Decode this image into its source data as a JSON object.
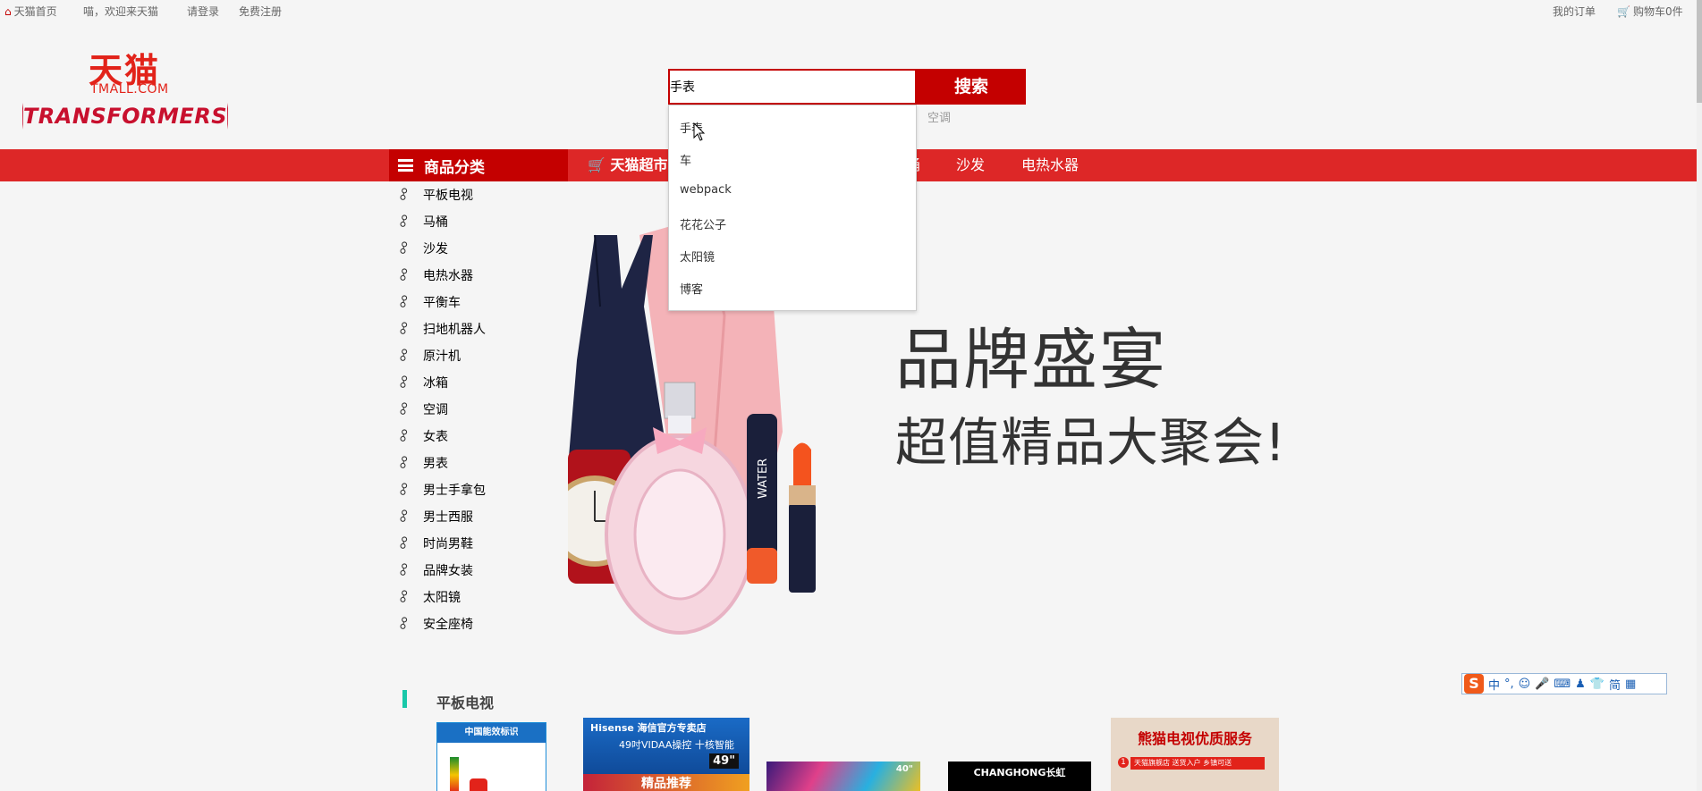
{
  "topbar": {
    "home": "天猫首页",
    "welcome": "喵，欢迎来天猫",
    "login": "请登录",
    "register": "免费注册",
    "orders": "我的订单",
    "cart": "购物车0件"
  },
  "logo": {
    "name_cn": "天猫",
    "domain": "TMALL.COM",
    "campaign": "TRANSFORMERS"
  },
  "search": {
    "value": "手表",
    "button": "搜索",
    "hot_words": [
      "空调"
    ],
    "suggestions": [
      "手表",
      "车",
      "webpack",
      "花花公子",
      "太阳镜",
      "博客"
    ]
  },
  "nav": {
    "category_label": "商品分类",
    "super_label": "天猫超市",
    "items_visible": [
      "桶",
      "沙发",
      "电热水器"
    ]
  },
  "categories": [
    "平板电视",
    "马桶",
    "沙发",
    "电热水器",
    "平衡车",
    "扫地机器人",
    "原汁机",
    "冰箱",
    "空调",
    "女表",
    "男表",
    "男士手拿包",
    "男士西服",
    "时尚男鞋",
    "品牌女装",
    "太阳镜",
    "安全座椅"
  ],
  "banner": {
    "line1": "品牌盛宴",
    "line2": "超值精品大聚会!",
    "watch_label": "WATER"
  },
  "section": {
    "title": "平板电视",
    "products": {
      "p1_header": "中国能效标识",
      "p2_brand": "Hisense 海信官方专卖店",
      "p2_line": "49吋VIDAA操控 十核智能",
      "p2_size": "49\"",
      "p2_bottom": "精品推荐",
      "p3_size": "40\"",
      "p4_brand": "CHANGHONG长虹",
      "p5_title": "熊猫电视优质服务",
      "p5_row1": "天猫旗舰店 送货入户 乡镇可送"
    }
  },
  "ime": {
    "mode": "中",
    "simp": "简"
  },
  "colors": {
    "brand_red": "#c40000",
    "nav_red": "#dd2727",
    "section_accent": "#19c8a9"
  }
}
